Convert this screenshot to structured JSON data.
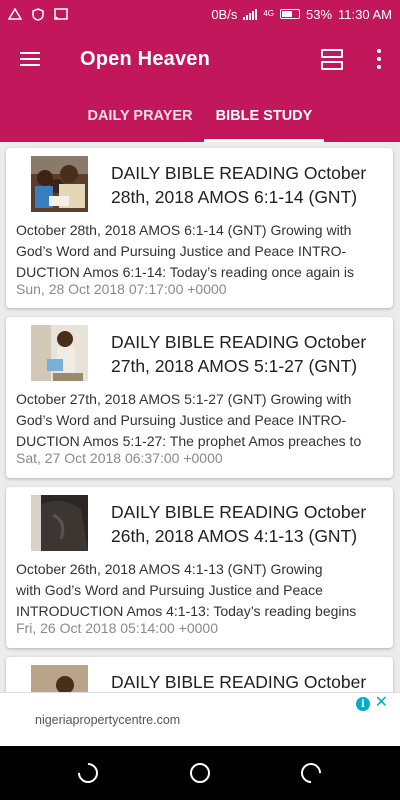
{
  "status_bar": {
    "speed": "0B/s",
    "network": "4G",
    "battery": "53%",
    "time": "11:30 AM"
  },
  "app_bar": {
    "title": "Open Heaven",
    "menu_icon": "hamburger-icon",
    "view_icon": "view-agenda-icon",
    "more_icon": "more-vert-icon"
  },
  "tabs": [
    {
      "label": "DAILY PRAYER",
      "active": false
    },
    {
      "label": "BIBLE STUDY",
      "active": true
    }
  ],
  "posts": [
    {
      "title": "DAILY BIBLE READING October 28th, 2018 AMOS 6:1-14 (GNT)",
      "excerpt_lines": [
        "October 28th, 2018 AMOS 6:1-14 (GNT) Growing with",
        "God’s Word and Pursuing Justice and Peace  INTRO-",
        "DUCTION Amos 6:1-14: Today’s reading once again is"
      ],
      "date": "Sun, 28 Oct 2018 07:17:00 +0000"
    },
    {
      "title": "DAILY BIBLE READING October 27th, 2018 AMOS 5:1-27 (GNT)",
      "excerpt_lines": [
        "October 27th, 2018 AMOS 5:1-27 (GNT) Growing with",
        "God’s Word and Pursuing Justice and Peace  INTRO-",
        "DUCTION Amos 5:1-27: The prophet Amos preaches to"
      ],
      "date": "Sat, 27 Oct 2018 06:37:00 +0000"
    },
    {
      "title": "DAILY BIBLE READING October 26th, 2018 AMOS 4:1-13 (GNT)",
      "excerpt_lines": [
        "October 26th, 2018 AMOS 4:1-13 (GNT) Growing",
        "with God’s Word and Pursuing Justice and Peace",
        "INTRODUCTION Amos 4:1-13: Today’s reading begins"
      ],
      "date": "Fri, 26 Oct 2018 05:14:00 +0000"
    },
    {
      "title": "DAILY BIBLE READING October"
    }
  ],
  "ad": {
    "url": "nigeriapropertycentre.com",
    "info_icon": "i",
    "close_icon": "✕"
  },
  "colors": {
    "primary": "#c2185b",
    "background": "#ececec",
    "ad_accent": "#00aecd"
  }
}
